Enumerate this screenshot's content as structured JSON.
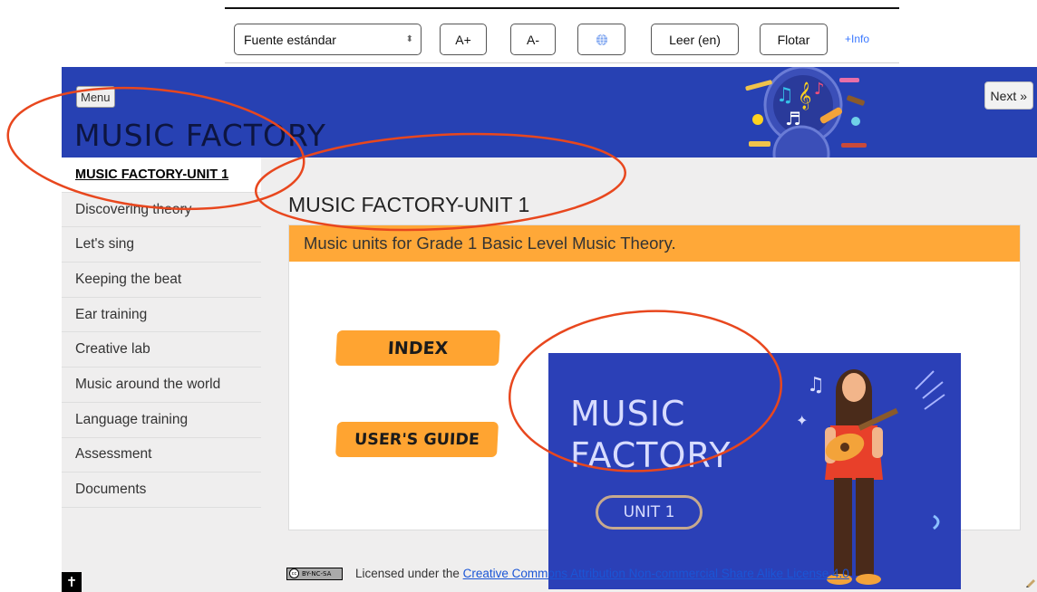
{
  "toolbar": {
    "font_select": "Fuente estándar",
    "increase_font": "A+",
    "decrease_font": "A-",
    "read_aloud": "Leer (en)",
    "float": "Flotar",
    "more_info": "+Info"
  },
  "header": {
    "menu_label": "Menu",
    "site_title": "MUSIC FACTORY",
    "next_label": "Next »",
    "banner_color": "#2741b3"
  },
  "sidebar": {
    "items": [
      {
        "label": "MUSIC FACTORY-UNIT 1",
        "active": true
      },
      {
        "label": "Discovering theory"
      },
      {
        "label": "Let's sing"
      },
      {
        "label": "Keeping the beat"
      },
      {
        "label": "Ear training"
      },
      {
        "label": "Creative lab"
      },
      {
        "label": "Music around the world"
      },
      {
        "label": "Language training"
      },
      {
        "label": "Assessment"
      },
      {
        "label": "Documents"
      }
    ]
  },
  "main": {
    "page_title": "MUSIC FACTORY-UNIT 1",
    "card_header": "Music units for Grade 1 Basic Level Music Theory.",
    "index_button": "INDEX",
    "guide_button": "USER'S GUIDE",
    "hero": {
      "title_line1": "MUSIC",
      "title_line2": "FACTORY",
      "unit_label": "UNIT 1"
    }
  },
  "footer": {
    "badge_text": "BY-NC-SA",
    "license_prefix": "Licensed under the",
    "license_link": "Creative Commons Attribution Non-commercial Share Alike License 4.0"
  },
  "colors": {
    "accent_orange": "#ffa838",
    "annotation_red": "#e8471e",
    "hero_blue": "#2b40b7"
  }
}
